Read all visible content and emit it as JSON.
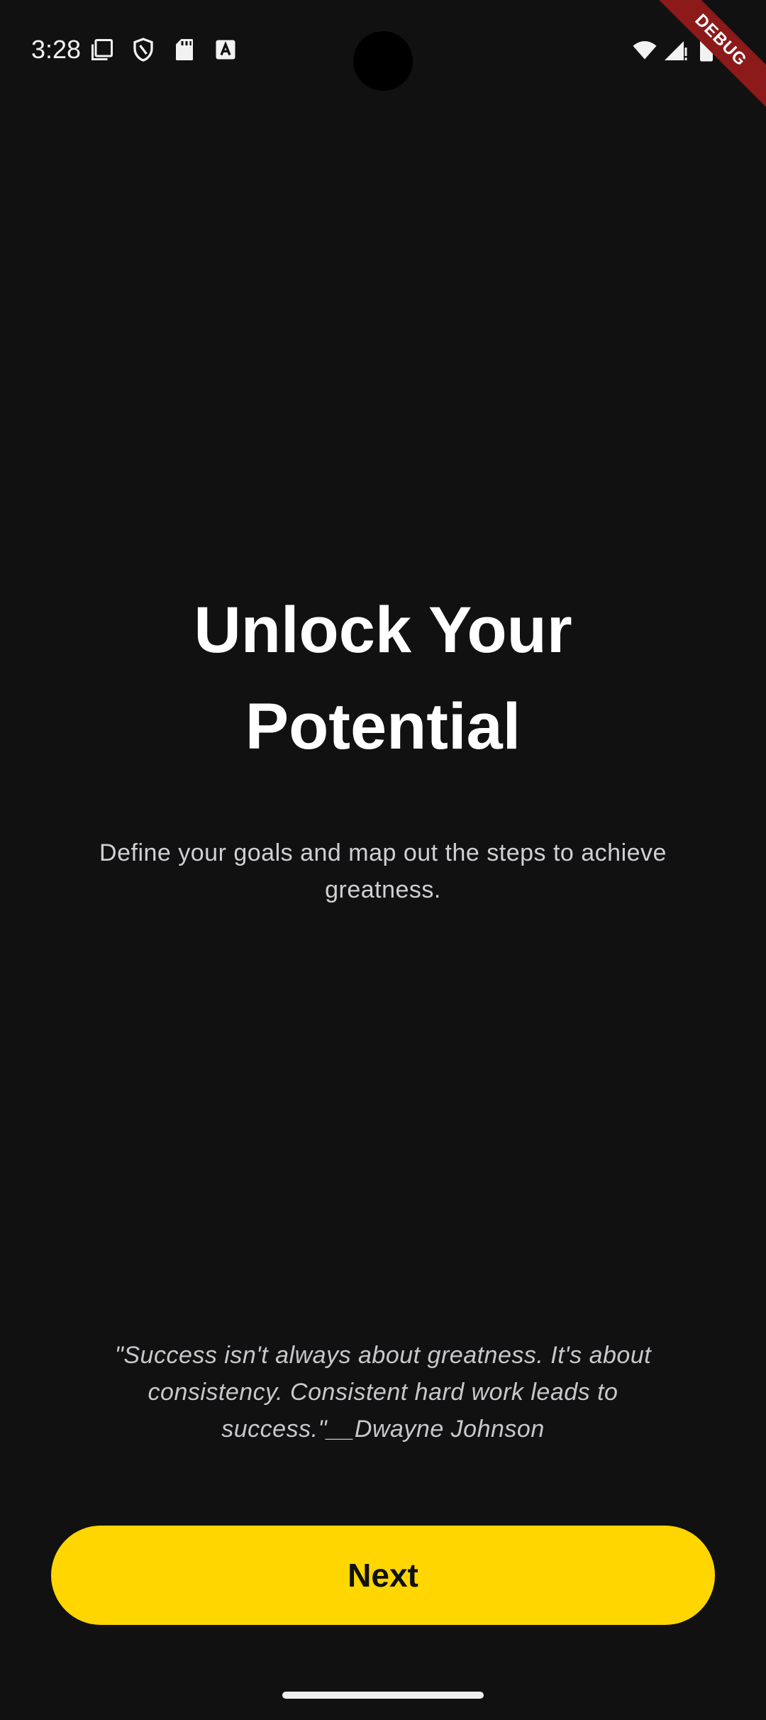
{
  "status_bar": {
    "time": "3:28",
    "left_icons": [
      "screenshot-icon",
      "shield-icon",
      "sd-card-icon",
      "text-a-icon"
    ],
    "right_icons": [
      "wifi-icon",
      "signal-icon",
      "battery-icon"
    ]
  },
  "debug_banner": {
    "label": "DEBUG",
    "color": "#8c1a1a"
  },
  "onboarding": {
    "title": "Unlock Your Potential",
    "subtitle": "Define your goals and map out the steps to achieve greatness.",
    "quote": "\"Success isn't always about greatness. It's about consistency. Consistent hard work leads to success.\"__Dwayne Johnson",
    "next_label": "Next"
  },
  "colors": {
    "background": "#111112",
    "accent": "#ffd600",
    "text_primary": "#ffffff",
    "text_secondary": "#d0d0d4"
  }
}
